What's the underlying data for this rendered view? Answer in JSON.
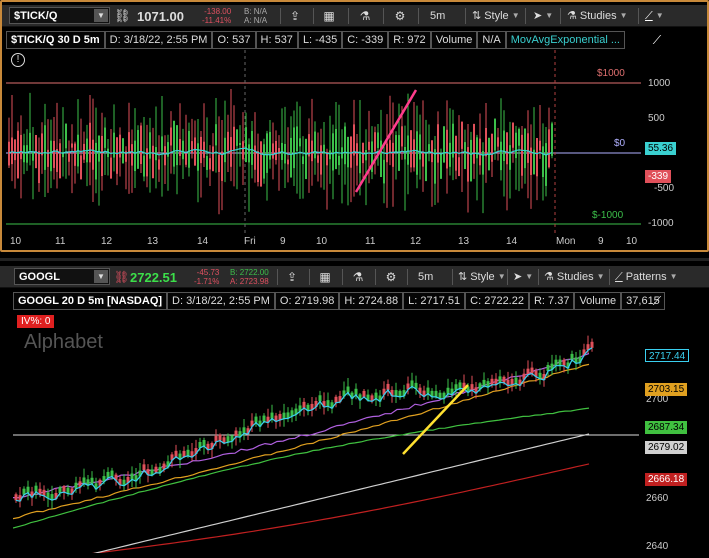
{
  "tick": {
    "symbol": "$TICK/Q",
    "last": "1071.00",
    "change1": "-138.00",
    "change2": "-11.41%",
    "bid": "B: N/A",
    "ask": "A: N/A",
    "timeframe": "5m",
    "style_label": "Style",
    "studies_label": "Studies",
    "info": {
      "name": "$TICK/Q 30 D 5m",
      "date": "D: 3/18/22, 2:55 PM",
      "open": "O: 537",
      "high": "H: 537",
      "low": "L: -435",
      "close": "C: -339",
      "range": "R: 972",
      "volume": "Volume",
      "volume_val": "N/A",
      "study": "MovAvgExponential ..."
    },
    "y_labels": [
      "1000",
      "500",
      "0",
      "-500",
      "-1000"
    ],
    "level_labels": {
      "top": "$1000",
      "zero": "$0",
      "bottom": "$-1000"
    },
    "price_tags": {
      "ema": "55.36",
      "last": "-339"
    },
    "x_labels": [
      "10",
      "11",
      "12",
      "13",
      "14",
      "Fri",
      "9",
      "10",
      "11",
      "12",
      "13",
      "14",
      "Mon",
      "9",
      "10"
    ],
    "colors": {
      "up": "#3cbf4a",
      "down": "#e0505a",
      "ema": "#3ad0d0",
      "trend": "#ff3c8c",
      "top_line": "#e07070",
      "zero_line": "#b0b0ff",
      "bottom_line": "#3cbf4a"
    }
  },
  "googl": {
    "symbol": "GOOGL",
    "last": "2722.51",
    "change1": "-45.73",
    "change2": "-1.71%",
    "bid": "B: 2722.00",
    "ask": "A: 2723.98",
    "timeframe": "5m",
    "style_label": "Style",
    "studies_label": "Studies",
    "patterns_label": "Patterns",
    "iv_label": "IV%: 0",
    "watermark": "Alphabet",
    "info": {
      "name": "GOOGL 20 D 5m [NASDAQ]",
      "date": "D: 3/18/22, 2:55 PM",
      "open": "O: 2719.98",
      "high": "H: 2724.88",
      "low": "L: 2717.51",
      "close": "C: 2722.22",
      "range": "R: 7.37",
      "volume": "Volume",
      "volume_val": "37,615"
    },
    "y_labels": [
      "2700",
      "2680",
      "2660",
      "2640"
    ],
    "price_tags": {
      "cyan": "2717.44",
      "orange": "2703.15",
      "green": "2687.34",
      "white": "2679.02",
      "red": "2666.18"
    },
    "colors": {
      "up": "#3cbf4a",
      "down": "#e0505a",
      "cyan": "#3ad0f0",
      "purple": "#b060e0",
      "orange": "#e0a020",
      "green": "#40c040",
      "white": "#d0d0d0",
      "red": "#c02020",
      "trend": "#ffe030"
    }
  }
}
